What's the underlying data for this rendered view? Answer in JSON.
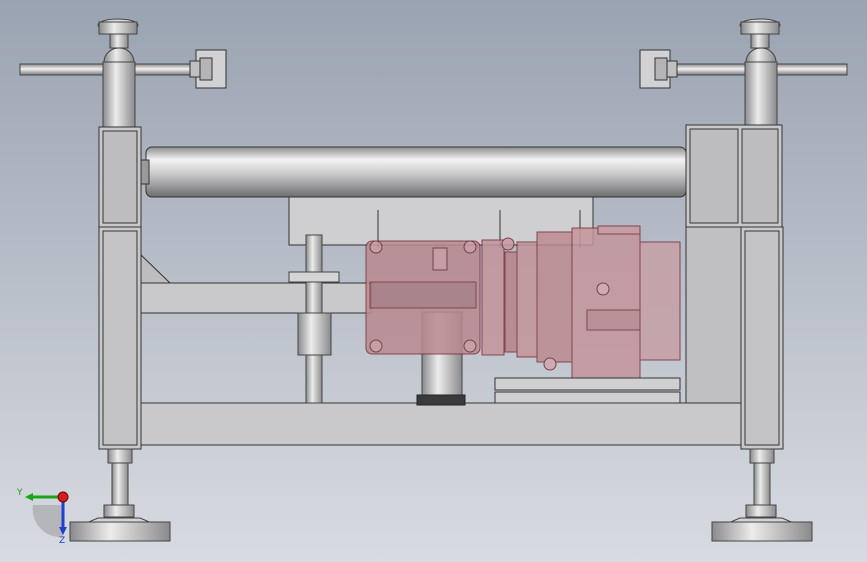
{
  "viewport": {
    "background_top": "#9ca4b2",
    "background_bottom": "#d6d9df"
  },
  "triad": {
    "x_label": "",
    "y_label": "Y",
    "z_label": "Z",
    "y_color": "#1aa51a",
    "z_color": "#1f3fd0",
    "x_color": "#d01f1f"
  },
  "colors": {
    "frame_fill": "#c9c9cc",
    "frame_stroke": "#333333",
    "gearbox_fill": "#b98a90",
    "gearbox_stroke": "#7a2f3a"
  }
}
